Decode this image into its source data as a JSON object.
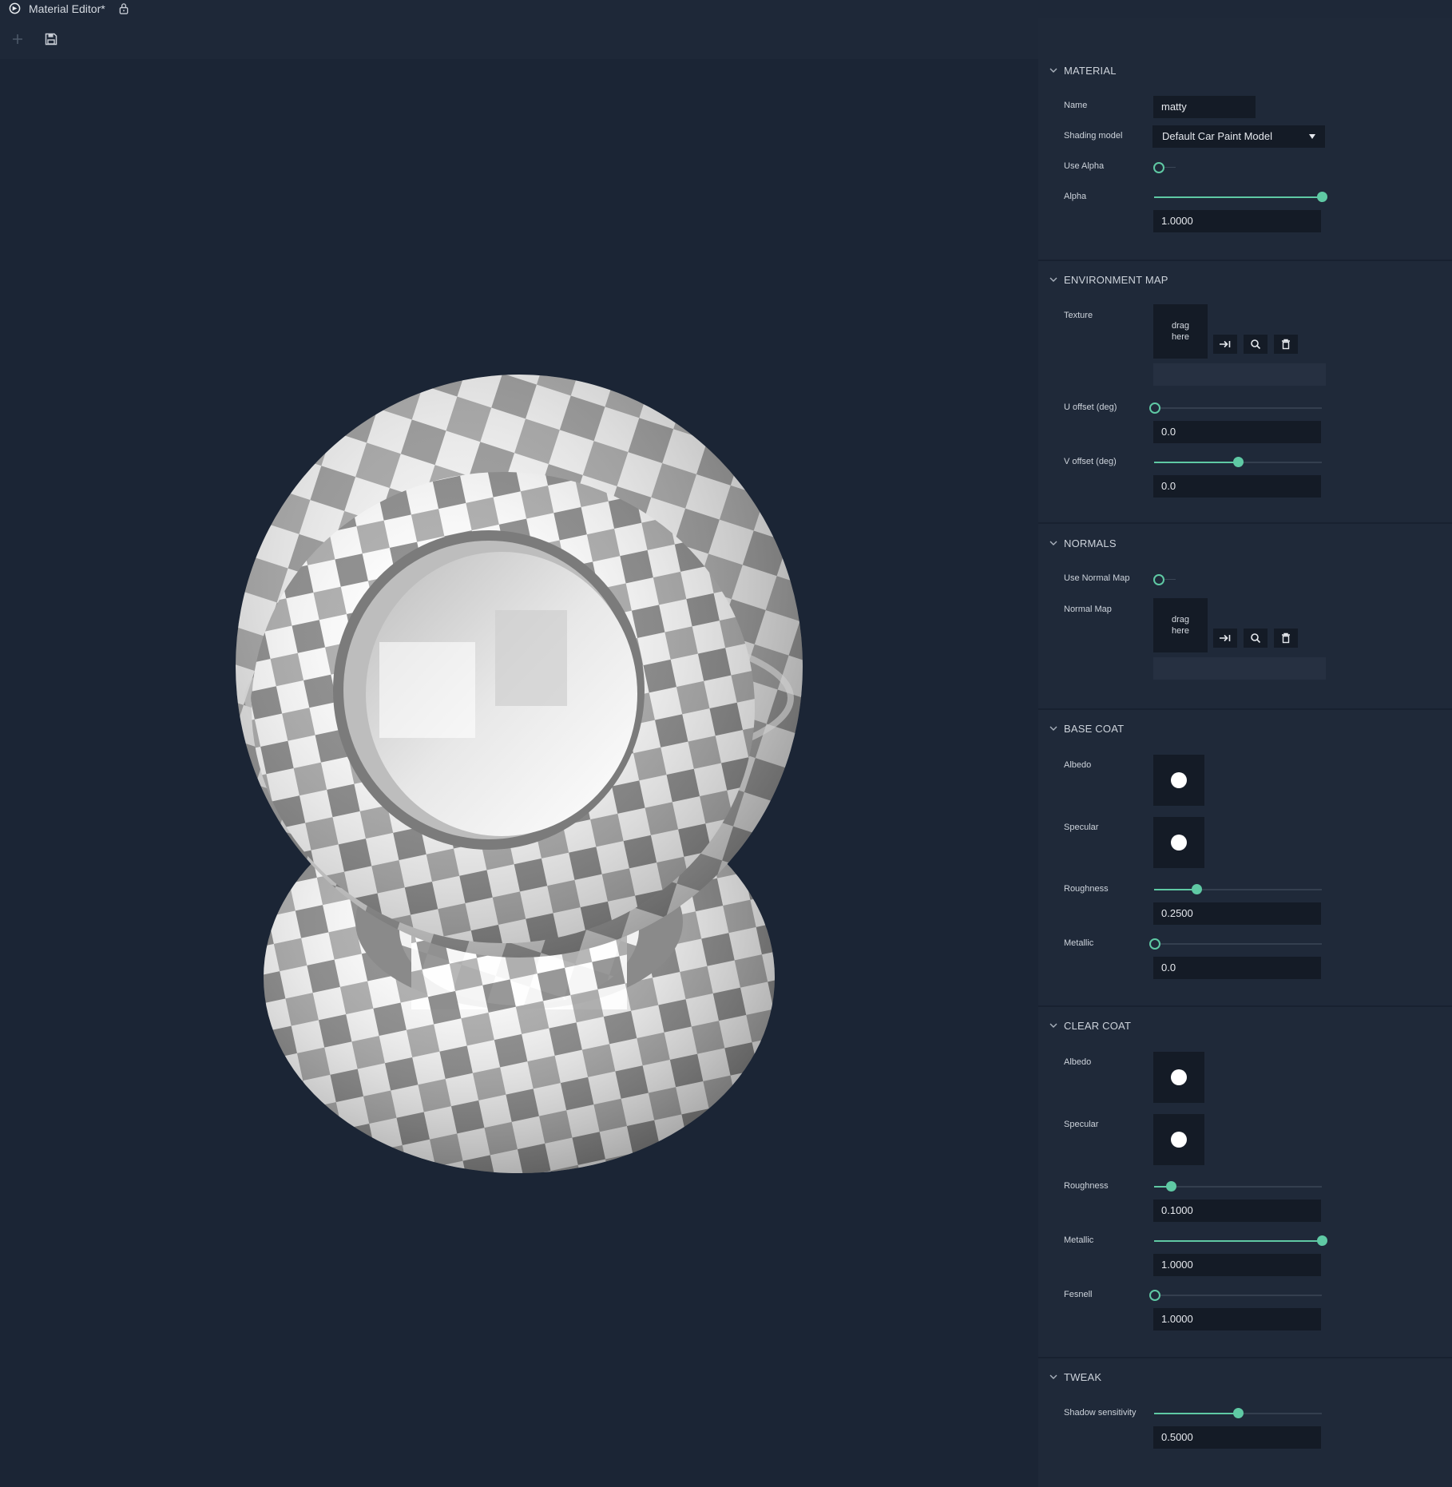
{
  "window": {
    "title": "Material Editor*"
  },
  "icons": {
    "logo": "app-logo-icon",
    "lock": "lock-icon",
    "add": "plus-icon",
    "save": "save-icon",
    "assign": "assign-arrow-icon",
    "search": "search-icon",
    "delete": "trash-icon",
    "collapse": "chevron-down-icon"
  },
  "colors": {
    "accent": "#5fc9a4",
    "background": "#1c2636",
    "panel": "#1f2939",
    "field": "#141b26"
  },
  "material": {
    "header": "MATERIAL",
    "name_label": "Name",
    "name_value": "matty",
    "shading_label": "Shading model",
    "shading_value": "Default Car Paint Model",
    "use_alpha_label": "Use Alpha",
    "use_alpha": false,
    "alpha_label": "Alpha",
    "alpha_value": "1.0000",
    "alpha_fraction": 1.0
  },
  "environment_map": {
    "header": "ENVIRONMENT MAP",
    "texture_label": "Texture",
    "drop_text": "drag here",
    "u_offset_label": "U offset (deg)",
    "u_offset_value": "0.0",
    "u_offset_fraction": 0.0,
    "v_offset_label": "V offset (deg)",
    "v_offset_value": "0.0",
    "v_offset_fraction": 0.5
  },
  "normals": {
    "header": "NORMALS",
    "use_normal_map_label": "Use Normal Map",
    "use_normal_map": false,
    "normal_map_label": "Normal Map",
    "drop_text": "drag here"
  },
  "base_coat": {
    "header": "BASE COAT",
    "albedo_label": "Albedo",
    "albedo_color": "#ffffff",
    "specular_label": "Specular",
    "specular_color": "#ffffff",
    "roughness_label": "Roughness",
    "roughness_value": "0.2500",
    "roughness_fraction": 0.25,
    "metallic_label": "Metallic",
    "metallic_value": "0.0",
    "metallic_fraction": 0.0
  },
  "clear_coat": {
    "header": "CLEAR COAT",
    "albedo_label": "Albedo",
    "albedo_color": "#ffffff",
    "specular_label": "Specular",
    "specular_color": "#ffffff",
    "roughness_label": "Roughness",
    "roughness_value": "0.1000",
    "roughness_fraction": 0.1,
    "metallic_label": "Metallic",
    "metallic_value": "1.0000",
    "metallic_fraction": 1.0,
    "fresnel_label": "Fesnell",
    "fresnel_value": "1.0000",
    "fresnel_fraction": 0.0
  },
  "tweak": {
    "header": "TWEAK",
    "shadow_label": "Shadow sensitivity",
    "shadow_value": "0.5000",
    "shadow_fraction": 0.5
  }
}
